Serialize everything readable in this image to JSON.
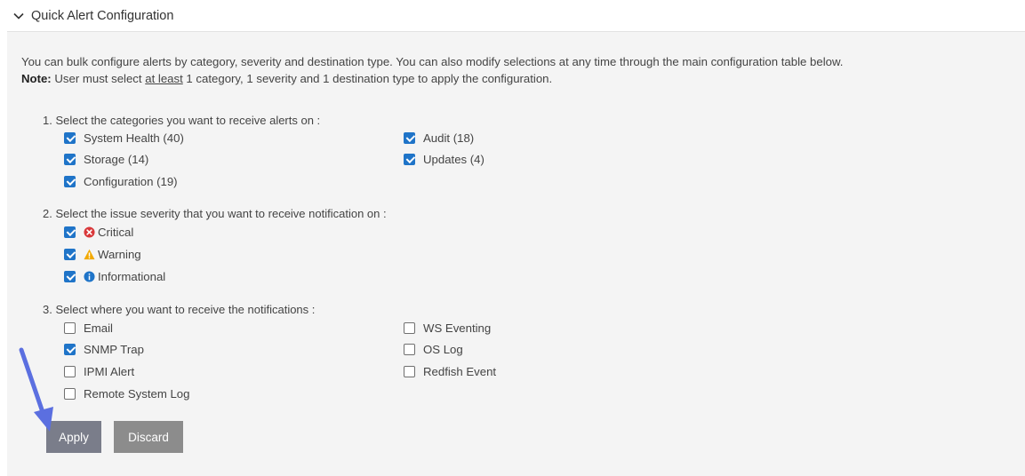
{
  "section": {
    "title": "Quick Alert Configuration"
  },
  "intro": {
    "line1": "You can bulk configure alerts by category, severity and destination type. You can also modify selections at any time through the main configuration table below.",
    "note_label": "Note:",
    "note_before": " User must select ",
    "note_underlined": "at least",
    "note_after": " 1 category, 1 severity and 1 destination type to apply the configuration."
  },
  "categories": {
    "prompt": "1. Select the categories you want to receive alerts on :",
    "items": [
      {
        "label": "System Health (40)",
        "checked": true
      },
      {
        "label": "Storage (14)",
        "checked": true
      },
      {
        "label": "Configuration (19)",
        "checked": true
      },
      {
        "label": "Audit (18)",
        "checked": true
      },
      {
        "label": "Updates (4)",
        "checked": true
      }
    ]
  },
  "severity": {
    "prompt": "2. Select the issue severity that you want to receive notification on :",
    "items": [
      {
        "label": "Critical",
        "checked": true,
        "icon": "critical-icon",
        "color": "#d9383a"
      },
      {
        "label": "Warning",
        "checked": true,
        "icon": "warning-icon",
        "color": "#f2a900"
      },
      {
        "label": "Informational",
        "checked": true,
        "icon": "info-icon",
        "color": "#1f74c8"
      }
    ]
  },
  "destinations": {
    "prompt": "3. Select where you want to receive the notifications :",
    "items": [
      {
        "label": "Email",
        "checked": false
      },
      {
        "label": "SNMP Trap",
        "checked": true
      },
      {
        "label": "IPMI Alert",
        "checked": false
      },
      {
        "label": "Remote System Log",
        "checked": false
      },
      {
        "label": "WS Eventing",
        "checked": false
      },
      {
        "label": "OS Log",
        "checked": false
      },
      {
        "label": "Redfish Event",
        "checked": false
      }
    ]
  },
  "buttons": {
    "apply": "Apply",
    "discard": "Discard"
  },
  "colors": {
    "checkbox": "#1f74c8",
    "arrow": "#5b6fe0",
    "apply_bg": "#7a7d8a",
    "discard_bg": "#8c8c8c"
  }
}
